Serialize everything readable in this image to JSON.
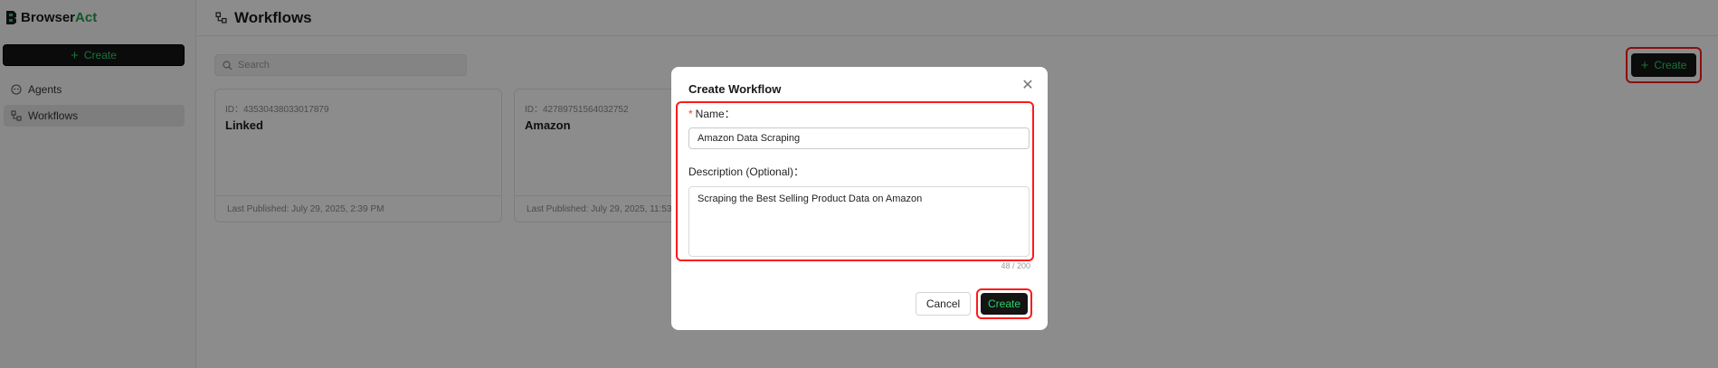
{
  "app": {
    "brand_part1": "Browser",
    "brand_part2": "Act",
    "create_label": "Create"
  },
  "sidebar": {
    "items": [
      {
        "label": "Agents",
        "icon": "agent-icon",
        "active": false
      },
      {
        "label": "Workflows",
        "icon": "workflow-icon",
        "active": true
      }
    ]
  },
  "header": {
    "title": "Workflows",
    "icon": "workflow-icon"
  },
  "search": {
    "placeholder": "Search"
  },
  "toolbar": {
    "create_label": "Create"
  },
  "cards": [
    {
      "id": "ID：435304380330178​79",
      "name": "Linked",
      "published": "Last Published: July 29, 2025, 2:39 PM"
    },
    {
      "id": "ID：427897515640327​52",
      "name": "Amazon",
      "published": "Last Published: July 29, 2025, 11:53 AM"
    }
  ],
  "modal": {
    "title": "Create Workflow",
    "name_label": "Name：",
    "name_value": "Amazon Data Scraping",
    "description_label": "Description (Optional)：",
    "description_value": "Scraping the Best Selling Product Data on Amazon",
    "counter": "48 / 200",
    "cancel_label": "Cancel",
    "create_label": "Create"
  },
  "colors": {
    "accent_green": "#28d26a",
    "button_dark": "#141414",
    "highlight_red": "#ff1a1a"
  }
}
